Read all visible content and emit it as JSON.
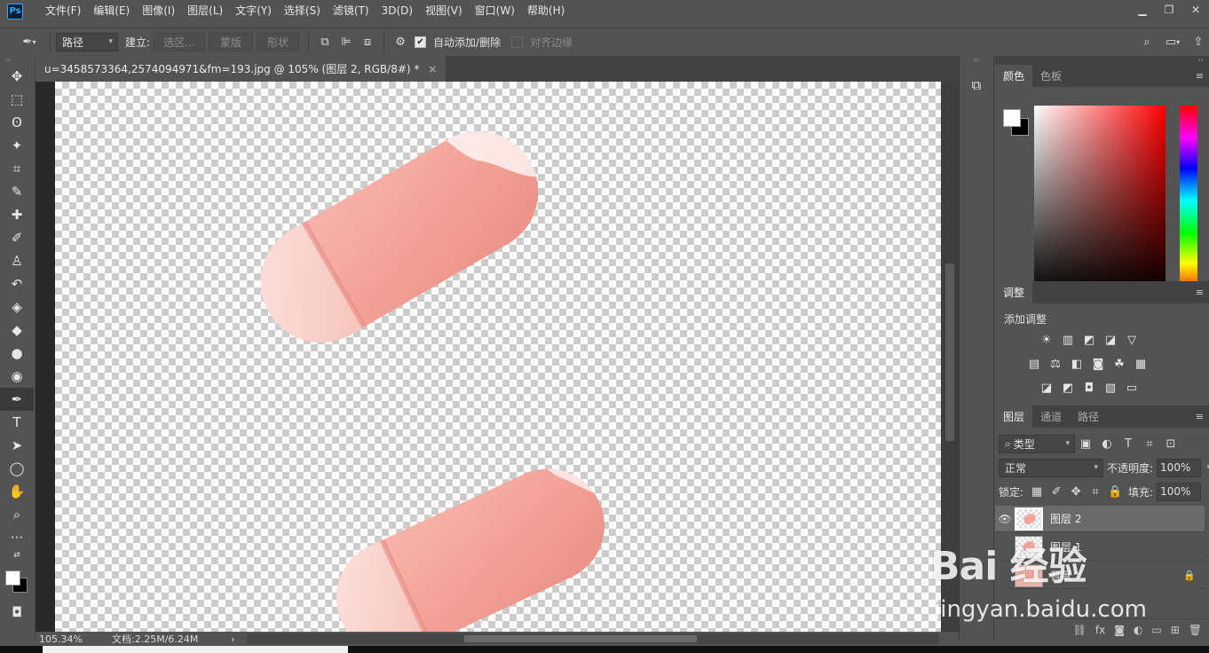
{
  "menubar": {
    "logo": "Ps",
    "items": [
      "文件(F)",
      "编辑(E)",
      "图像(I)",
      "图层(L)",
      "文字(Y)",
      "选择(S)",
      "滤镜(T)",
      "3D(D)",
      "视图(V)",
      "窗口(W)",
      "帮助(H)"
    ],
    "window_controls": [
      "minimize-icon",
      "restore-icon",
      "close-icon"
    ]
  },
  "options": {
    "mode_select": "路径",
    "make_label": "建立:",
    "btn_selection": "选区...",
    "btn_mask": "蒙版",
    "btn_shape": "形状",
    "auto_add_label": "自动添加/删除",
    "auto_add_checked": true,
    "align_edges_label": "对齐边缘",
    "align_edges_checked": false
  },
  "document": {
    "tab_title": "u=3458573364,2574094971&fm=193.jpg @ 105% (图层 2, RGB/8#) *",
    "close_glyph": "×"
  },
  "status": {
    "zoom": "105.34%",
    "doc_info": "文档:2.25M/6.24M",
    "arrow": "›"
  },
  "tools": [
    {
      "name": "move-tool-icon",
      "glyph": "✥"
    },
    {
      "name": "marquee-tool-icon",
      "glyph": "⬚"
    },
    {
      "name": "lasso-tool-icon",
      "glyph": "ʘ"
    },
    {
      "name": "magic-wand-tool-icon",
      "glyph": "✦"
    },
    {
      "name": "crop-tool-icon",
      "glyph": "⌗"
    },
    {
      "name": "eyedropper-tool-icon",
      "glyph": "✎"
    },
    {
      "name": "healing-brush-tool-icon",
      "glyph": "✚"
    },
    {
      "name": "brush-tool-icon",
      "glyph": "✐"
    },
    {
      "name": "clone-stamp-tool-icon",
      "glyph": "♙"
    },
    {
      "name": "history-brush-tool-icon",
      "glyph": "↶"
    },
    {
      "name": "eraser-tool-icon",
      "glyph": "◈"
    },
    {
      "name": "paint-bucket-tool-icon",
      "glyph": "◆"
    },
    {
      "name": "dodge-tool-icon",
      "glyph": "●"
    },
    {
      "name": "sponge-tool-icon",
      "glyph": "◉"
    },
    {
      "name": "pen-tool-icon",
      "glyph": "✒",
      "active": true
    },
    {
      "name": "type-tool-icon",
      "glyph": "T"
    },
    {
      "name": "path-selection-tool-icon",
      "glyph": "➤"
    },
    {
      "name": "ellipse-tool-icon",
      "glyph": "◯"
    },
    {
      "name": "hand-tool-icon",
      "glyph": "✋"
    },
    {
      "name": "zoom-tool-icon",
      "glyph": "⌕"
    },
    {
      "name": "more-tools-icon",
      "glyph": "···"
    }
  ],
  "color_panel": {
    "tabs": [
      "颜色",
      "色板"
    ],
    "fg_color": "#ffffff",
    "bg_color": "#000000"
  },
  "adjustments_panel": {
    "tabs": [
      "调整"
    ],
    "title": "添加调整",
    "rows": [
      [
        "brightness-icon",
        "levels-icon",
        "curves-icon",
        "exposure-icon",
        "vibrance-icon"
      ],
      [
        "hue-saturation-icon",
        "color-balance-icon",
        "black-white-icon",
        "photo-filter-icon",
        "channel-mixer-icon",
        "color-lookup-icon"
      ],
      [
        "invert-icon",
        "posterize-icon",
        "threshold-icon",
        "selective-color-icon",
        "gradient-map-icon"
      ]
    ],
    "glyphs": [
      [
        "☀",
        "▥",
        "◩",
        "◪",
        "▽"
      ],
      [
        "▤",
        "⚖",
        "◧",
        "◙",
        "☘",
        "▦"
      ],
      [
        "◪",
        "◩",
        "◘",
        "▧",
        "▭"
      ]
    ]
  },
  "layers_panel": {
    "tabs": [
      "图层",
      "通道",
      "路径"
    ],
    "filter_label": "类型",
    "blend_mode": "正常",
    "opacity_label": "不透明度:",
    "opacity_value": "100%",
    "lock_label": "锁定:",
    "fill_label": "填充:",
    "fill_value": "100%",
    "layers": [
      {
        "name": "图层 2",
        "visible": true,
        "selected": true,
        "locked": false
      },
      {
        "name": "图层 1",
        "visible": false,
        "selected": false,
        "locked": false
      },
      {
        "name": "背景",
        "visible": false,
        "selected": false,
        "locked": true
      }
    ],
    "footer_icons": [
      "link-icon",
      "fx-icon",
      "mask-icon",
      "adjustment-icon",
      "group-icon",
      "new-layer-icon",
      "delete-icon"
    ],
    "footer_glyphs": [
      "⛓",
      "fx",
      "◙",
      "◐",
      "▭",
      "⊞",
      "🗑"
    ]
  },
  "watermark": {
    "text": "Bai 经验",
    "sub": "jingyan.baidu.com"
  },
  "colors": {
    "panel_bg": "#535353",
    "dark_bg": "#424242",
    "accent": "#31a8ff",
    "nail_pink": "#f4a49a",
    "nail_tip": "#fbd6d2"
  }
}
